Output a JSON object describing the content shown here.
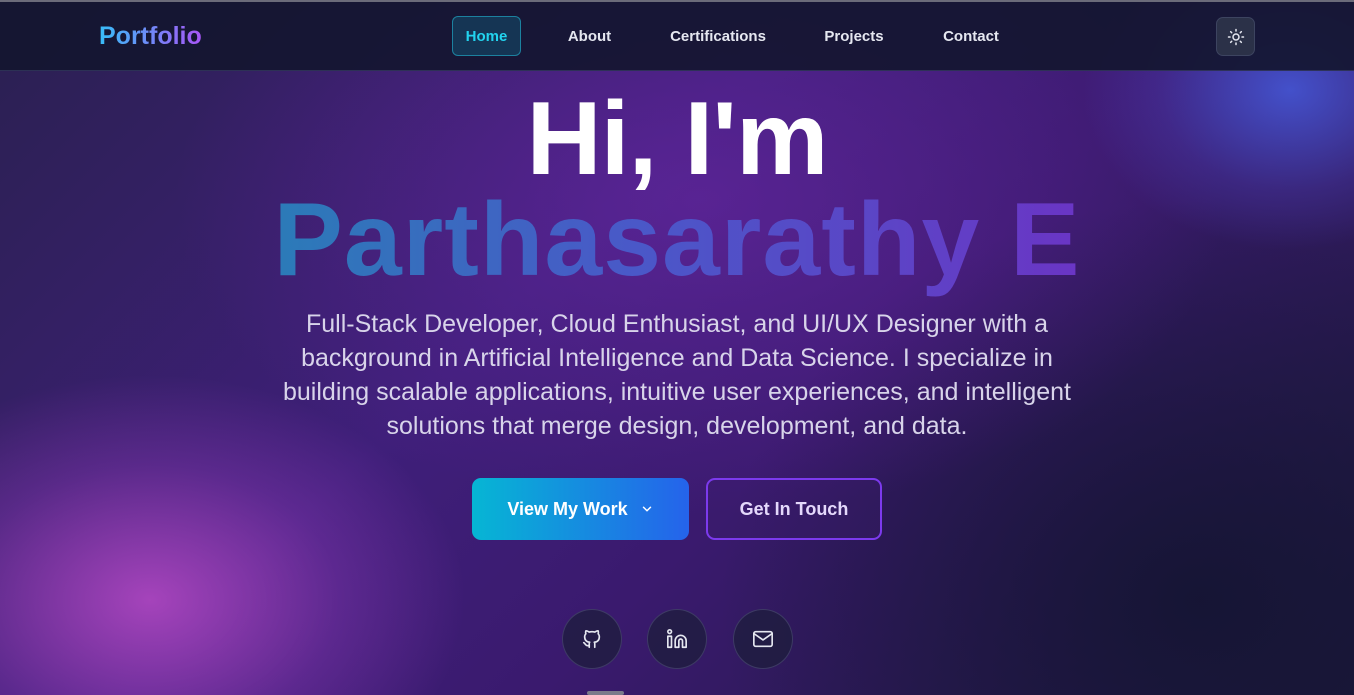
{
  "navbar": {
    "logo": "Portfolio",
    "items": [
      {
        "label": "Home",
        "active": true
      },
      {
        "label": "About",
        "active": false
      },
      {
        "label": "Certifications",
        "active": false
      },
      {
        "label": "Projects",
        "active": false
      },
      {
        "label": "Contact",
        "active": false
      }
    ],
    "theme_toggle_icon": "sun-icon"
  },
  "hero": {
    "greeting": "Hi, I'm",
    "name": "Parthasarathy E",
    "description": "Full-Stack Developer, Cloud Enthusiast, and UI/UX Designer with a background in Artificial Intelligence and Data Science. I specialize in building scalable applications, intuitive user experiences, and intelligent solutions that merge design, development, and data.",
    "primary_button": {
      "label": "View My Work",
      "icon": "chevron-down-icon"
    },
    "secondary_button": {
      "label": "Get In Touch"
    }
  },
  "social_links": [
    {
      "icon": "github-icon"
    },
    {
      "icon": "linkedin-icon"
    },
    {
      "icon": "mail-icon"
    }
  ],
  "colors": {
    "accent_cyan": "#22d3ee",
    "accent_purple": "#7c3aed",
    "primary_gradient_start": "#06b6d4",
    "primary_gradient_end": "#2563eb"
  }
}
